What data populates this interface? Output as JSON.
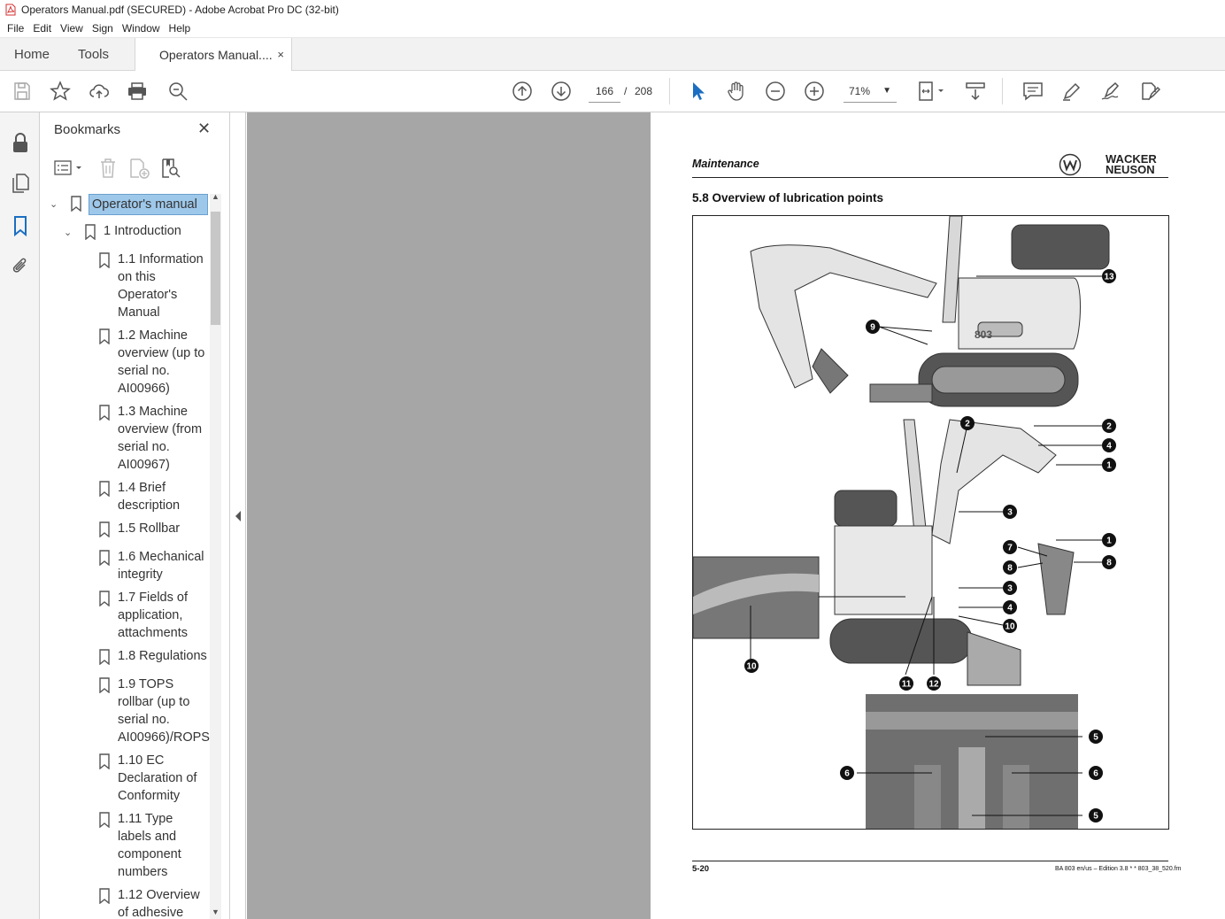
{
  "window": {
    "title": "Operators Manual.pdf (SECURED) - Adobe Acrobat Pro DC (32-bit)"
  },
  "menu": [
    "File",
    "Edit",
    "View",
    "Sign",
    "Window",
    "Help"
  ],
  "tabs": {
    "home": "Home",
    "tools": "Tools",
    "document": "Operators Manual....",
    "close": "×"
  },
  "toolbar": {
    "page_current": "166",
    "page_separator": "/",
    "page_total": "208",
    "zoom": "71%"
  },
  "bookmarks_panel": {
    "title": "Bookmarks",
    "close": "✕",
    "items": [
      {
        "label": "Operator's manual",
        "level": 0,
        "expanded": true,
        "selected": true
      },
      {
        "label": "1 Introduction",
        "level": 1,
        "expanded": true
      },
      {
        "label": "1.1 Information on this Operator's Manual",
        "level": 2,
        "lines": [
          "1.1 Information",
          "on this",
          "Operator's",
          "Manual"
        ]
      },
      {
        "label": "1.2 Machine overview (up to serial no. AI00966)",
        "level": 2,
        "lines": [
          "1.2 Machine",
          "overview (up to",
          "serial no.",
          "AI00966)"
        ]
      },
      {
        "label": "1.3 Machine overview (from serial no. AI00967)",
        "level": 2,
        "lines": [
          "1.3 Machine",
          "overview (from",
          "serial no.",
          "AI00967)"
        ]
      },
      {
        "label": "1.4 Brief description",
        "level": 2,
        "lines": [
          "1.4 Brief",
          "description"
        ]
      },
      {
        "label": "1.5 Rollbar",
        "level": 2,
        "lines": [
          "1.5 Rollbar"
        ]
      },
      {
        "label": "1.6 Mechanical integrity",
        "level": 2,
        "lines": [
          "1.6 Mechanical",
          "integrity"
        ]
      },
      {
        "label": "1.7 Fields of application, attachments",
        "level": 2,
        "lines": [
          "1.7 Fields of",
          "application,",
          "attachments"
        ]
      },
      {
        "label": "1.8 Regulations",
        "level": 2,
        "lines": [
          "1.8 Regulations"
        ]
      },
      {
        "label": "1.9 TOPS rollbar (up to serial no. AI00966)/ROPS",
        "level": 2,
        "lines": [
          "1.9 TOPS",
          "rollbar (up to",
          "serial no.",
          "AI00966)/ROPS"
        ]
      },
      {
        "label": "1.10 EC Declaration of Conformity",
        "level": 2,
        "lines": [
          "1.10 EC",
          "Declaration of",
          "Conformity"
        ]
      },
      {
        "label": "1.11 Type labels and component numbers",
        "level": 2,
        "lines": [
          "1.11 Type",
          "labels and",
          "component",
          "numbers"
        ]
      },
      {
        "label": "1.12 Overview of adhesive",
        "level": 2,
        "lines": [
          "1.12 Overview",
          "of adhesive"
        ]
      }
    ]
  },
  "document_page": {
    "section_header": "Maintenance",
    "logo_text": [
      "WACKER",
      "NEUSON"
    ],
    "section_title": "5.8   Overview of lubrication points",
    "figure_callouts": [
      "1",
      "2",
      "3",
      "4",
      "5",
      "6",
      "7",
      "8",
      "9",
      "10",
      "11",
      "12",
      "13"
    ],
    "machine_label": "803",
    "footer_left": "5-20",
    "footer_right": "BA 803 en/us – Edition 3.8 * * 803_38_520.fm"
  },
  "colors": {
    "selection": "#9ec8ea",
    "gray_area": "#a6a6a6",
    "accent_blue": "#1b6ec2",
    "pdf_red": "#d32f2f"
  }
}
